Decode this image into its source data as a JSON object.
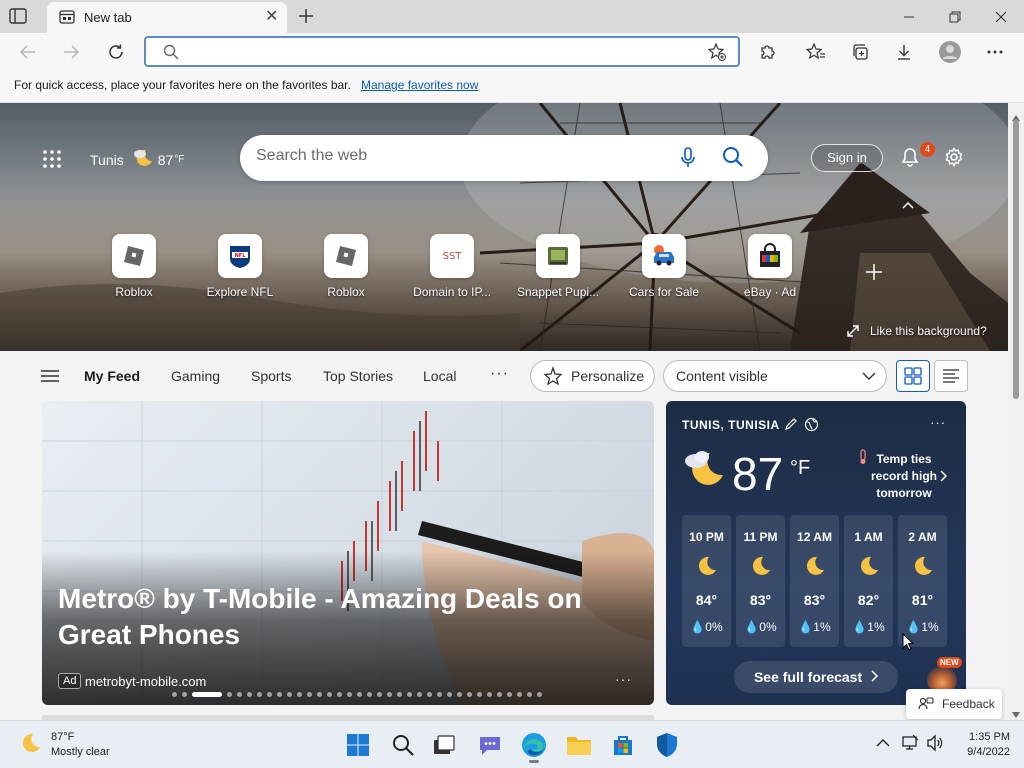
{
  "browser": {
    "tab_title": "New tab",
    "address_placeholder": ""
  },
  "favorites_bar": {
    "text": "For quick access, place your favorites here on the favorites bar.",
    "link": "Manage favorites now"
  },
  "hero": {
    "city": "Tunis",
    "temp": "87",
    "temp_unit": "°F",
    "search_placeholder": "Search the web",
    "sign_in": "Sign in",
    "notification_count": "4",
    "like_background": "Like this background?"
  },
  "tiles": [
    {
      "label": "Roblox",
      "icon": "roblox-icon"
    },
    {
      "label": "Explore NFL",
      "icon": "nfl-icon"
    },
    {
      "label": "Roblox",
      "icon": "roblox-icon"
    },
    {
      "label": "Domain to IP...",
      "icon": "sst-icon",
      "glyph": "SST"
    },
    {
      "label": "Snappet Pupi...",
      "icon": "snappet-icon"
    },
    {
      "label": "Cars for Sale",
      "icon": "car-icon"
    },
    {
      "label": "eBay · Ad",
      "icon": "ebay-bag-icon"
    }
  ],
  "feed_nav": {
    "items": [
      "My Feed",
      "Gaming",
      "Sports",
      "Top Stories",
      "Local"
    ],
    "more": "···",
    "personalize": "Personalize",
    "content_visibility": "Content visible"
  },
  "ad": {
    "title": "Metro® by T-Mobile - Amazing Deals on Great Phones",
    "badge": "Ad",
    "source": "metrobyt-mobile.com",
    "more": "···",
    "carousel_count": 35,
    "carousel_active": 2
  },
  "weather_card": {
    "location": "TUNIS, TUNISIA",
    "temp": "87",
    "unit": "°F",
    "alert": "Temp ties record high tomorrow",
    "more": "···",
    "hours": [
      {
        "time": "10 PM",
        "temp": "84°",
        "precip": "0%"
      },
      {
        "time": "11 PM",
        "temp": "83°",
        "precip": "0%"
      },
      {
        "time": "12 AM",
        "temp": "83°",
        "precip": "1%"
      },
      {
        "time": "1 AM",
        "temp": "82°",
        "precip": "1%"
      },
      {
        "time": "2 AM",
        "temp": "81°",
        "precip": "1%"
      }
    ],
    "forecast_button": "See full forecast",
    "new_badge": "NEW"
  },
  "feedback": "Feedback",
  "taskbar": {
    "weather_temp": "87°F",
    "weather_desc": "Mostly clear",
    "time": "1:35 PM",
    "date": "9/4/2022"
  },
  "colors": {
    "accent": "#0a5bc4",
    "notification_badge": "#e04a1a",
    "weather_card_bg": "#1d2c44"
  }
}
